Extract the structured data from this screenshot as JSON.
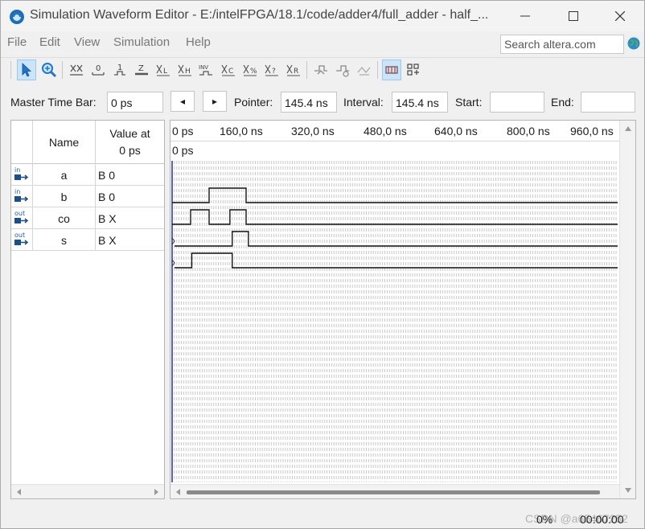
{
  "window": {
    "title": "Simulation Waveform Editor - E:/intelFPGA/18.1/code/adder4/full_adder - half_..."
  },
  "menu": [
    "File",
    "Edit",
    "View",
    "Simulation",
    "Help"
  ],
  "search": {
    "placeholder": "Search altera.com"
  },
  "toolbar": {
    "items": [
      "selection-tool-icon",
      "zoom-tool-icon",
      "force-unknown-icon",
      "force-low-icon",
      "force-high-icon",
      "force-high-impedance-icon",
      "weak-low-icon",
      "weak-high-icon",
      "invert-icon",
      "count-value-icon",
      "forcing-clock-icon",
      "arbitrary-value-icon",
      "random-value-icon",
      "snap-to-grid-icon",
      "group-icon",
      "ungroup-icon",
      "grid-toggle-icon",
      "align-icon"
    ],
    "glyphs": {
      "force_low": "0",
      "force_high": "1",
      "force_z": "Z",
      "weak_low": "L",
      "weak_high": "H",
      "invert": "INV",
      "clock": "C",
      "count": "%",
      "arbitrary": "?",
      "random": "R"
    }
  },
  "timebar": {
    "master_label": "Master Time Bar:",
    "master_value": "0 ps",
    "prev_arrow": "◂",
    "next_arrow": "▸",
    "pointer_label": "Pointer:",
    "pointer_value": "145.4 ns",
    "interval_label": "Interval:",
    "interval_value": "145.4 ns",
    "start_label": "Start:",
    "start_value": "",
    "end_label": "End:",
    "end_value": ""
  },
  "signal_table": {
    "name_header": "Name",
    "value_header_line1": "Value at",
    "value_header_line2": "0 ps"
  },
  "signals": [
    {
      "direction": "in",
      "name": "a",
      "value": "B 0"
    },
    {
      "direction": "in",
      "name": "b",
      "value": "B 0"
    },
    {
      "direction": "out",
      "name": "co",
      "value": "B X"
    },
    {
      "direction": "out",
      "name": "s",
      "value": "B X"
    }
  ],
  "ruler": {
    "ticks": [
      "0 ps",
      "160,0 ns",
      "320,0 ns",
      "480,0 ns",
      "640,0 ns",
      "800,0 ns",
      "960,0 ns"
    ],
    "cursor_label": "0 ps"
  },
  "waveforms": {
    "time_unit": "ns",
    "a": [
      [
        0,
        0
      ],
      [
        160,
        1
      ],
      [
        320,
        0
      ]
    ],
    "b": [
      [
        0,
        0
      ],
      [
        80,
        1
      ],
      [
        160,
        0
      ],
      [
        250,
        1
      ],
      [
        320,
        0
      ]
    ],
    "co": [
      [
        0,
        "X"
      ],
      [
        260,
        1
      ],
      [
        330,
        0
      ]
    ],
    "s": [
      [
        0,
        "X"
      ],
      [
        85,
        1
      ],
      [
        260,
        0
      ]
    ]
  },
  "status": {
    "progress": "0%",
    "elapsed": "00:00:00",
    "watermark": "CSDN @a65467252"
  }
}
